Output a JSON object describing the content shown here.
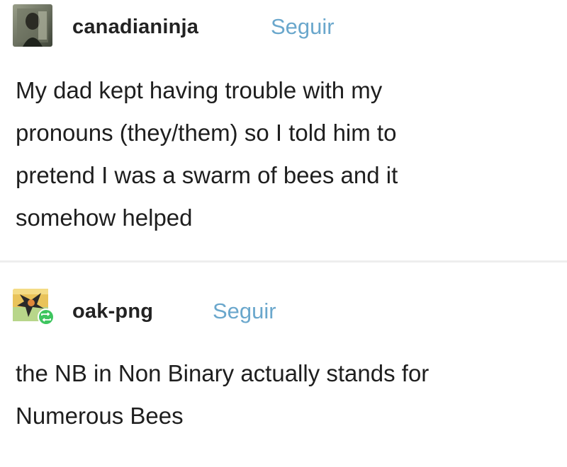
{
  "post1": {
    "username": "canadianinja",
    "follow_label": "Seguir",
    "lines": [
      "My dad kept having trouble with my",
      "pronouns (they/them) so I told him to",
      "pretend I was a swarm of bees and it",
      "somehow helped"
    ]
  },
  "post2": {
    "username": "oak-png",
    "follow_label": "Seguir",
    "lines": [
      "the NB in Non Binary actually stands for",
      "Numerous Bees"
    ]
  },
  "colors": {
    "follow": "#6aa7cc",
    "reblog_badge": "#3ec55f",
    "divider": "#eeeeee"
  }
}
